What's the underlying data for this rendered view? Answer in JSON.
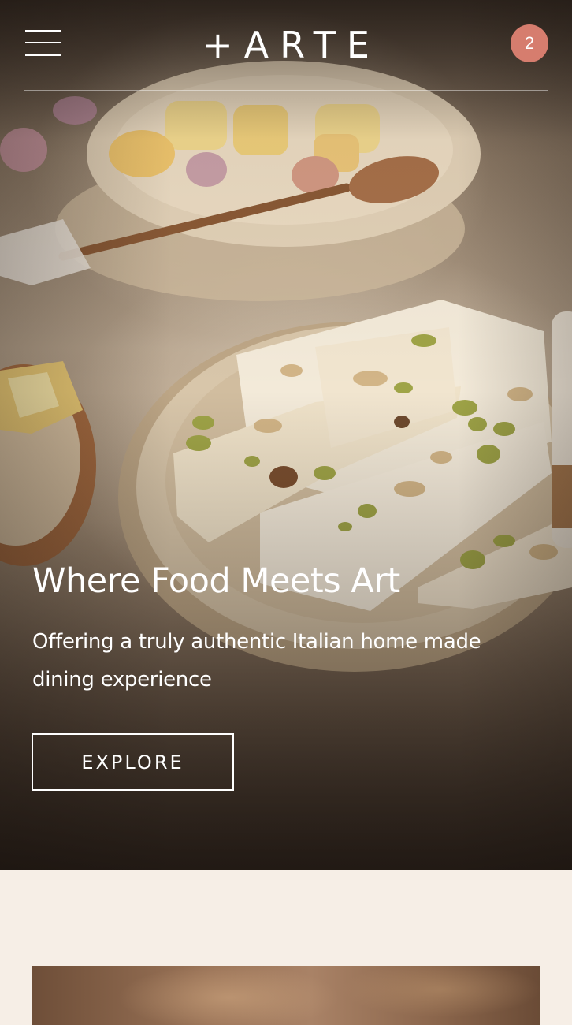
{
  "header": {
    "logo": "+ARTE",
    "cart_count": "2"
  },
  "hero": {
    "title": "Where Food Meets Art",
    "subtitle": "Offering a truly authentic Italian home made dining experience",
    "cta_label": "EXPLORE"
  },
  "colors": {
    "accent": "#d67d6e",
    "page_background": "#f6eee6",
    "hero_text": "#ffffff"
  },
  "icons": {
    "menu": "hamburger-icon"
  }
}
